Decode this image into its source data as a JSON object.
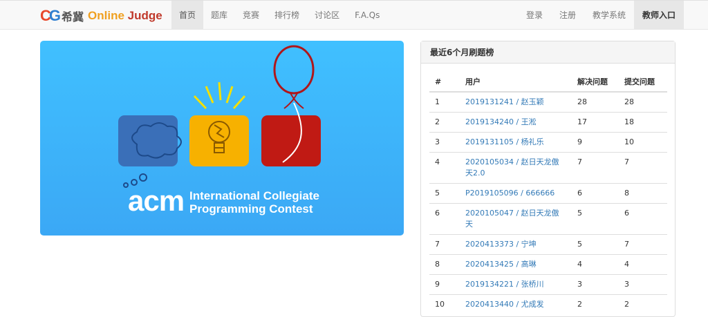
{
  "brand": {
    "logo_text": "CG",
    "cn": "希冀",
    "en_online": "Online",
    "en_judge": "Judge"
  },
  "nav_left": [
    {
      "label": "首页",
      "active": true
    },
    {
      "label": "题库",
      "active": false
    },
    {
      "label": "竞赛",
      "active": false
    },
    {
      "label": "排行榜",
      "active": false
    },
    {
      "label": "讨论区",
      "active": false
    },
    {
      "label": "F.A.Qs",
      "active": false
    }
  ],
  "nav_right": {
    "login": "登录",
    "register": "注册",
    "teaching": "教学系统",
    "teacher": "教师入口"
  },
  "banner": {
    "acm": "acm",
    "line1": "International Collegiate",
    "line2": "Programming Contest"
  },
  "ranking": {
    "title": "最近6个月刷题榜",
    "headers": [
      "#",
      "用户",
      "解决问题",
      "提交问题"
    ],
    "rows": [
      {
        "rank": "1",
        "user": "2019131241 / 赵玉颖",
        "solved": "28",
        "submitted": "28"
      },
      {
        "rank": "2",
        "user": "2019134240 / 王淞",
        "solved": "17",
        "submitted": "18"
      },
      {
        "rank": "3",
        "user": "2019131105 / 杨礼乐",
        "solved": "9",
        "submitted": "10"
      },
      {
        "rank": "4",
        "user": "2020105034 / 赵日天龙傲天2.0",
        "solved": "7",
        "submitted": "7"
      },
      {
        "rank": "5",
        "user": "P2019105096 / 666666",
        "solved": "6",
        "submitted": "8"
      },
      {
        "rank": "6",
        "user": "2020105047 / 赵日天龙傲天",
        "solved": "5",
        "submitted": "6"
      },
      {
        "rank": "7",
        "user": "2020413373 / 宁坤",
        "solved": "5",
        "submitted": "7"
      },
      {
        "rank": "8",
        "user": "2020413425 / 高琳",
        "solved": "4",
        "submitted": "4"
      },
      {
        "rank": "9",
        "user": "2019134221 / 张桥川",
        "solved": "3",
        "submitted": "3"
      },
      {
        "rank": "10",
        "user": "2020413440 / 尤成发",
        "solved": "2",
        "submitted": "2"
      }
    ]
  }
}
